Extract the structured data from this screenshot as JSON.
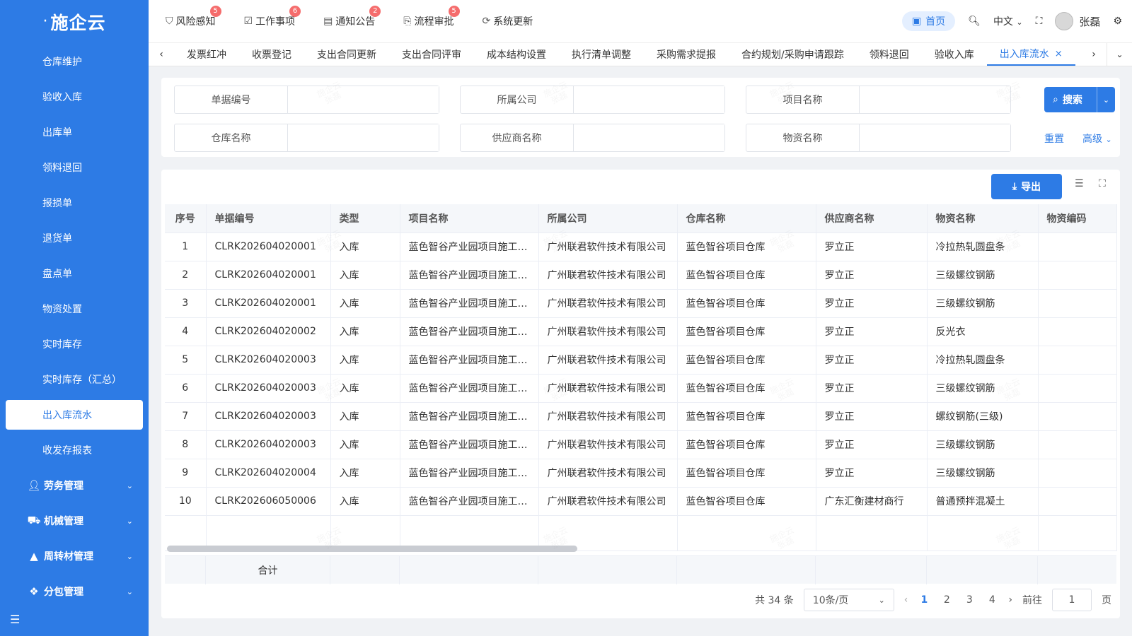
{
  "app": {
    "logo_text": "施企云"
  },
  "sidebar": {
    "items": [
      {
        "label": "仓库维护"
      },
      {
        "label": "验收入库"
      },
      {
        "label": "出库单"
      },
      {
        "label": "领料退回"
      },
      {
        "label": "报损单"
      },
      {
        "label": "退货单"
      },
      {
        "label": "盘点单"
      },
      {
        "label": "物资处置"
      },
      {
        "label": "实时库存"
      },
      {
        "label": "实时库存（汇总）"
      },
      {
        "label": "出入库流水",
        "active": true
      },
      {
        "label": "收发存报表"
      }
    ],
    "groups": [
      {
        "label": "劳务管理",
        "icon": "worker-icon"
      },
      {
        "label": "机械管理",
        "icon": "truck-icon"
      },
      {
        "label": "周转材管理",
        "icon": "cone-icon"
      },
      {
        "label": "分包管理",
        "icon": "puzzle-icon"
      }
    ]
  },
  "header": {
    "notices": [
      {
        "label": "风险感知",
        "badge": "5",
        "icon": "shield-icon"
      },
      {
        "label": "工作事项",
        "badge": "6",
        "icon": "task-icon"
      },
      {
        "label": "通知公告",
        "badge": "2",
        "icon": "notice-icon"
      },
      {
        "label": "流程审批",
        "badge": "5",
        "icon": "approval-icon"
      },
      {
        "label": "系统更新",
        "badge": "",
        "icon": "update-icon"
      }
    ],
    "home_label": "首页",
    "language": "中文",
    "user_name": "张磊"
  },
  "tabs": [
    {
      "label": "发票红冲"
    },
    {
      "label": "收票登记"
    },
    {
      "label": "支出合同更新"
    },
    {
      "label": "支出合同评审"
    },
    {
      "label": "成本结构设置"
    },
    {
      "label": "执行清单调整"
    },
    {
      "label": "采购需求提报"
    },
    {
      "label": "合约规划/采购申请跟踪"
    },
    {
      "label": "领料退回"
    },
    {
      "label": "验收入库"
    },
    {
      "label": "出入库流水",
      "active": true
    }
  ],
  "filters": {
    "doc_no": {
      "label": "单据编号",
      "value": ""
    },
    "company": {
      "label": "所属公司",
      "value": ""
    },
    "project": {
      "label": "项目名称",
      "value": ""
    },
    "warehouse": {
      "label": "仓库名称",
      "value": ""
    },
    "supplier": {
      "label": "供应商名称",
      "value": ""
    },
    "material": {
      "label": "物资名称",
      "value": ""
    },
    "search_label": "搜索",
    "reset_label": "重置",
    "advanced_label": "高级"
  },
  "toolbar": {
    "export_label": "导出"
  },
  "table": {
    "columns": [
      "序号",
      "单据编号",
      "类型",
      "项目名称",
      "所属公司",
      "仓库名称",
      "供应商名称",
      "物资名称",
      "物资编码"
    ],
    "rows": [
      [
        "1",
        "CLRK202604020001",
        "入库",
        "蓝色智谷产业园项目施工…",
        "广州联君软件技术有限公司",
        "蓝色智谷项目仓库",
        "罗立正",
        "冷拉热轧圆盘条",
        ""
      ],
      [
        "2",
        "CLRK202604020001",
        "入库",
        "蓝色智谷产业园项目施工…",
        "广州联君软件技术有限公司",
        "蓝色智谷项目仓库",
        "罗立正",
        "三级螺纹钢筋",
        ""
      ],
      [
        "3",
        "CLRK202604020001",
        "入库",
        "蓝色智谷产业园项目施工…",
        "广州联君软件技术有限公司",
        "蓝色智谷项目仓库",
        "罗立正",
        "三级螺纹钢筋",
        ""
      ],
      [
        "4",
        "CLRK202604020002",
        "入库",
        "蓝色智谷产业园项目施工…",
        "广州联君软件技术有限公司",
        "蓝色智谷项目仓库",
        "罗立正",
        "反光衣",
        ""
      ],
      [
        "5",
        "CLRK202604020003",
        "入库",
        "蓝色智谷产业园项目施工…",
        "广州联君软件技术有限公司",
        "蓝色智谷项目仓库",
        "罗立正",
        "冷拉热轧圆盘条",
        ""
      ],
      [
        "6",
        "CLRK202604020003",
        "入库",
        "蓝色智谷产业园项目施工…",
        "广州联君软件技术有限公司",
        "蓝色智谷项目仓库",
        "罗立正",
        "三级螺纹钢筋",
        ""
      ],
      [
        "7",
        "CLRK202604020003",
        "入库",
        "蓝色智谷产业园项目施工…",
        "广州联君软件技术有限公司",
        "蓝色智谷项目仓库",
        "罗立正",
        "螺纹钢筋(三级)",
        ""
      ],
      [
        "8",
        "CLRK202604020003",
        "入库",
        "蓝色智谷产业园项目施工…",
        "广州联君软件技术有限公司",
        "蓝色智谷项目仓库",
        "罗立正",
        "三级螺纹钢筋",
        ""
      ],
      [
        "9",
        "CLRK202604020004",
        "入库",
        "蓝色智谷产业园项目施工…",
        "广州联君软件技术有限公司",
        "蓝色智谷项目仓库",
        "罗立正",
        "三级螺纹钢筋",
        ""
      ],
      [
        "10",
        "CLRK202606050006",
        "入库",
        "蓝色智谷产业园项目施工…",
        "广州联君软件技术有限公司",
        "蓝色智谷项目仓库",
        "广东汇衡建材商行",
        "普通预拌混凝土",
        ""
      ]
    ],
    "summary_label": "合计"
  },
  "pagination": {
    "total_text": "共 34 条",
    "page_size": "10条/页",
    "pages": [
      "1",
      "2",
      "3",
      "4"
    ],
    "current": "1",
    "goto_label": "前往",
    "goto_value": "1",
    "page_suffix": "页"
  },
  "watermark": {
    "text": "施企云",
    "user": "张磊"
  },
  "colors": {
    "primary": "#2d7be5",
    "badge": "#f56c6c"
  }
}
